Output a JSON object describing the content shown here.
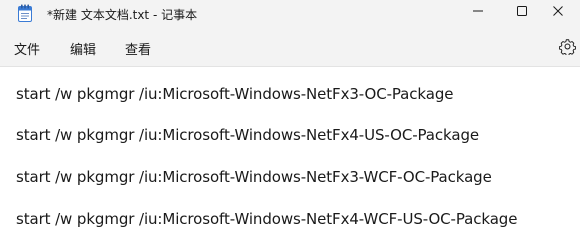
{
  "window": {
    "title": "*新建 文本文档.txt - 记事本"
  },
  "menu": {
    "file": "文件",
    "edit": "编辑",
    "view": "查看"
  },
  "icons": {
    "app": "notepad-icon",
    "minimize": "minimize-icon",
    "maximize": "maximize-icon",
    "close": "close-icon",
    "settings": "gear-icon"
  },
  "editor": {
    "lines": [
      "start /w pkgmgr /iu:Microsoft-Windows-NetFx3-OC-Package",
      "start /w pkgmgr /iu:Microsoft-Windows-NetFx4-US-OC-Package",
      "start /w pkgmgr /iu:Microsoft-Windows-NetFx3-WCF-OC-Package",
      "start /w pkgmgr /iu:Microsoft-Windows-NetFx4-WCF-US-OC-Package"
    ]
  },
  "colors": {
    "titlebar_bg": "#f3f3f3",
    "editor_bg": "#ffffff",
    "text": "#1a1a1a",
    "accent": "#3a7bd5"
  }
}
